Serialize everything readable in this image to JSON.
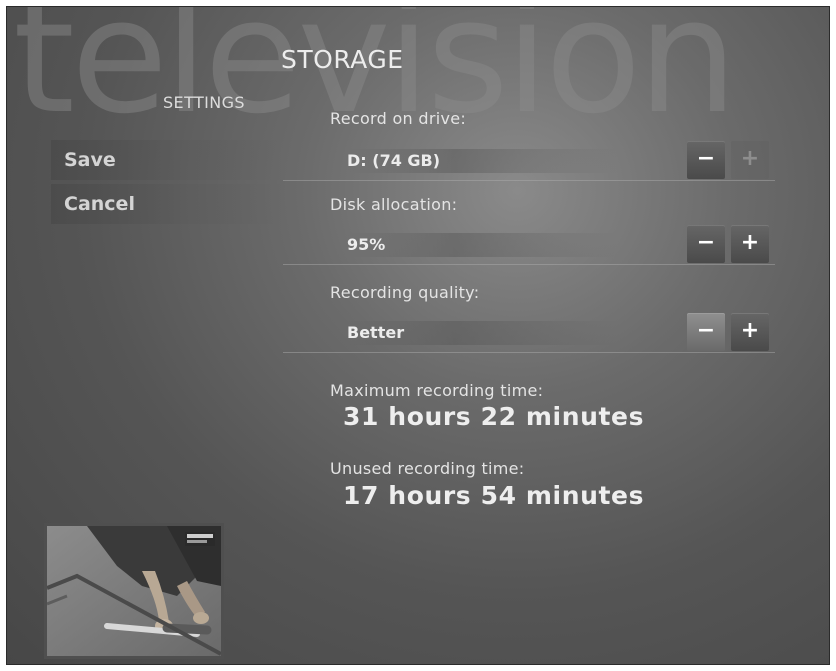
{
  "background_word": "television",
  "page_title": "STORAGE",
  "section_label": "SETTINGS",
  "menu": {
    "save_label": "Save",
    "cancel_label": "Cancel"
  },
  "settings": [
    {
      "label": "Record on drive:",
      "value": "D: (74 GB)",
      "minus": "−",
      "plus": "+",
      "minus_enabled": true,
      "plus_enabled": false
    },
    {
      "label": "Disk allocation:",
      "value": "95%",
      "minus": "−",
      "plus": "+",
      "minus_enabled": true,
      "plus_enabled": true
    },
    {
      "label": "Recording quality:",
      "value": "Better",
      "minus": "−",
      "plus": "+",
      "minus_enabled": true,
      "plus_enabled": true,
      "minus_highlighted": true
    }
  ],
  "info": {
    "max_label": "Maximum recording time:",
    "max_value": "31 hours 22 minutes",
    "unused_label": "Unused recording time:",
    "unused_value": "17 hours 54 minutes"
  },
  "preview": {
    "icon": "live-tv-preview"
  },
  "colors": {
    "background": "#5e5e5e",
    "text": "#ececec",
    "button": "#555555"
  }
}
